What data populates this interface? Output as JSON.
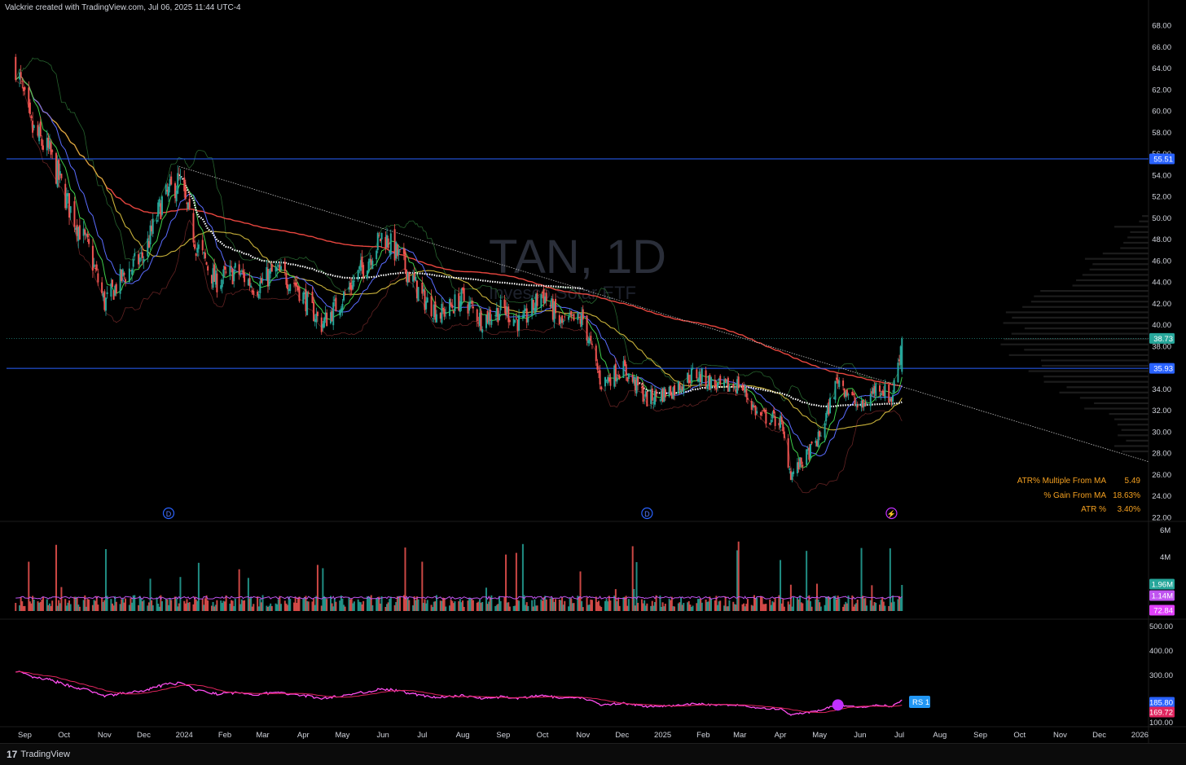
{
  "header": {
    "caption": "Valckrie created with TradingView.com, Jul 06, 2025 11:44 UTC-4"
  },
  "footer": {
    "brand": "TradingView",
    "logo": "17"
  },
  "watermark": {
    "symbol": "TAN, 1D",
    "name": "Invesco Solar ETF"
  },
  "colors": {
    "up": "#26a69a",
    "down": "#ef5350",
    "ma_red": "#e8463f",
    "ma_yellow": "#c9b23a",
    "ma_blue": "#5a6cff",
    "ma_green": "#3fcf4a",
    "band": "#2f7a38",
    "level": "#2962ff",
    "rs": "#ff4df0",
    "rs_ma": "#e0245e",
    "rs_up": "#2196f3",
    "vol_ma": "#c054f0"
  },
  "stats": [
    {
      "label": "ATR% Multiple From MA",
      "value": "5.49"
    },
    {
      "label": "% Gain From MA",
      "value": "18.63%"
    },
    {
      "label": "ATR %",
      "value": "3.40%"
    }
  ],
  "chart_data": {
    "type": "candlestick",
    "symbol": "TAN",
    "timeframe": "1D",
    "x_axis_labels": [
      "Sep",
      "Oct",
      "Nov",
      "Dec",
      "2024",
      "Feb",
      "Mar",
      "Apr",
      "May",
      "Jun",
      "Jul",
      "Aug",
      "Sep",
      "Oct",
      "Nov",
      "Dec",
      "2025",
      "Feb",
      "Mar",
      "Apr",
      "May",
      "Jun",
      "Jul",
      "Aug",
      "Sep",
      "Oct",
      "Nov",
      "Dec",
      "2026"
    ],
    "price_axis": {
      "ticks": [
        22,
        24,
        26,
        28,
        30,
        32,
        34,
        36,
        38,
        40,
        42,
        44,
        46,
        48,
        50,
        52,
        54,
        56,
        58,
        60,
        62,
        64,
        66,
        68
      ],
      "ylim": [
        22,
        68
      ]
    },
    "price_tags": [
      {
        "value": "55.51",
        "kind": "level"
      },
      {
        "value": "38.73",
        "kind": "last"
      },
      {
        "value": "35.93",
        "kind": "level"
      }
    ],
    "horizontal_levels": [
      55.51,
      35.93
    ],
    "last_price": 38.73,
    "price_path": [
      {
        "date": "2023-08-25",
        "close": 64.5
      },
      {
        "date": "2023-09-05",
        "close": 58.5
      },
      {
        "date": "2023-09-20",
        "close": 56.0
      },
      {
        "date": "2023-10-05",
        "close": 51.0
      },
      {
        "date": "2023-10-20",
        "close": 47.0
      },
      {
        "date": "2023-11-01",
        "close": 42.0
      },
      {
        "date": "2023-11-15",
        "close": 44.5
      },
      {
        "date": "2023-12-01",
        "close": 46.5
      },
      {
        "date": "2023-12-15",
        "close": 51.5
      },
      {
        "date": "2023-12-28",
        "close": 53.5
      },
      {
        "date": "2024-01-10",
        "close": 47.5
      },
      {
        "date": "2024-01-25",
        "close": 44.0
      },
      {
        "date": "2024-02-10",
        "close": 45.0
      },
      {
        "date": "2024-02-25",
        "close": 43.5
      },
      {
        "date": "2024-03-10",
        "close": 45.0
      },
      {
        "date": "2024-03-25",
        "close": 44.0
      },
      {
        "date": "2024-04-15",
        "close": 40.0
      },
      {
        "date": "2024-05-01",
        "close": 42.5
      },
      {
        "date": "2024-05-20",
        "close": 46.0
      },
      {
        "date": "2024-06-01",
        "close": 48.5
      },
      {
        "date": "2024-06-15",
        "close": 46.0
      },
      {
        "date": "2024-07-01",
        "close": 42.5
      },
      {
        "date": "2024-07-15",
        "close": 41.0
      },
      {
        "date": "2024-08-01",
        "close": 42.5
      },
      {
        "date": "2024-08-15",
        "close": 40.5
      },
      {
        "date": "2024-09-01",
        "close": 41.5
      },
      {
        "date": "2024-09-15",
        "close": 40.0
      },
      {
        "date": "2024-10-01",
        "close": 43.0
      },
      {
        "date": "2024-10-15",
        "close": 40.0
      },
      {
        "date": "2024-11-01",
        "close": 40.5
      },
      {
        "date": "2024-11-15",
        "close": 34.5
      },
      {
        "date": "2024-12-01",
        "close": 36.0
      },
      {
        "date": "2024-12-20",
        "close": 33.0
      },
      {
        "date": "2025-01-10",
        "close": 34.0
      },
      {
        "date": "2025-01-25",
        "close": 35.5
      },
      {
        "date": "2025-02-15",
        "close": 34.0
      },
      {
        "date": "2025-03-01",
        "close": 34.5
      },
      {
        "date": "2025-03-15",
        "close": 31.5
      },
      {
        "date": "2025-04-01",
        "close": 31.0
      },
      {
        "date": "2025-04-09",
        "close": 26.0
      },
      {
        "date": "2025-04-20",
        "close": 27.5
      },
      {
        "date": "2025-05-01",
        "close": 29.5
      },
      {
        "date": "2025-05-15",
        "close": 35.0
      },
      {
        "date": "2025-06-01",
        "close": 32.0
      },
      {
        "date": "2025-06-15",
        "close": 34.5
      },
      {
        "date": "2025-06-25",
        "close": 33.0
      },
      {
        "date": "2025-07-03",
        "close": 38.73
      }
    ],
    "volume_axis": {
      "ticks": [
        "6M",
        "4M"
      ]
    },
    "volume_tags": [
      {
        "value": "1.96M",
        "kind": "volume"
      },
      {
        "value": "1.14M",
        "kind": "volume_ma"
      },
      {
        "value": "72.84",
        "kind": "indicator"
      }
    ],
    "rs_axis": {
      "ticks": [
        "500.00",
        "400.00",
        "300.00",
        "100.00"
      ]
    },
    "rs_tags": [
      {
        "value": "185.80",
        "kind": "rs"
      },
      {
        "value": "169.72",
        "kind": "rs_ma"
      }
    ],
    "rs_label": "RS 1",
    "event_markers": [
      {
        "date": "2023-12-20",
        "glyph": "D"
      },
      {
        "date": "2024-12-20",
        "glyph": "D"
      },
      {
        "date": "2025-06-25",
        "glyph": "⚡"
      }
    ]
  }
}
